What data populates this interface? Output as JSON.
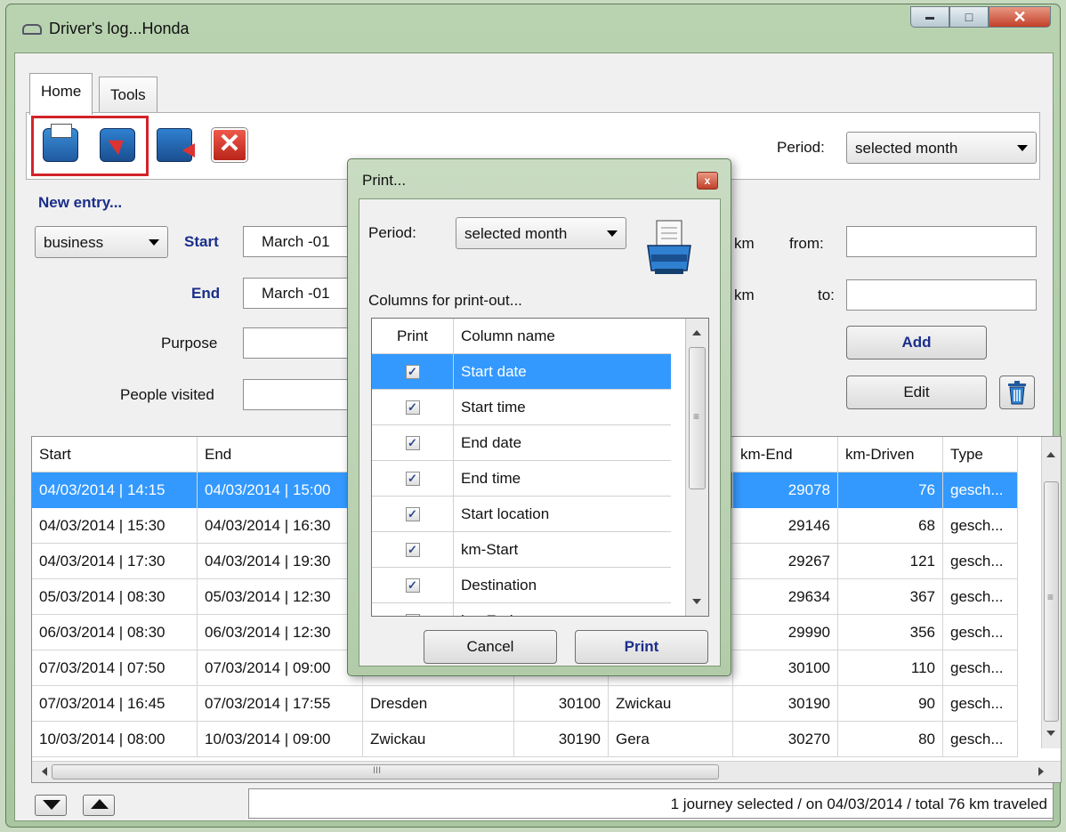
{
  "window": {
    "title": "Driver's log...Honda",
    "min_glyph": "▬",
    "max_glyph": "□",
    "close_glyph": "✕"
  },
  "tabs": [
    {
      "label": "Home"
    },
    {
      "label": "Tools"
    }
  ],
  "toolbar": {
    "period_label": "Period:",
    "period_value": "selected month"
  },
  "entry": {
    "heading": "New entry...",
    "type_value": "business",
    "start_label": "Start",
    "start_value": "March  -01",
    "end_label": "End",
    "end_value": "March  -01",
    "purpose_label": "Purpose",
    "purpose_value": "",
    "people_label": "People visited",
    "people_value": "",
    "km_label_1": "km",
    "from_label": "from:",
    "from_value": "",
    "km_label_2": "km",
    "to_label": "to:",
    "to_value": "",
    "add_label": "Add",
    "edit_label": "Edit"
  },
  "grid": {
    "columns": [
      "Start",
      "End",
      "",
      "",
      "",
      "km-End",
      "km-Driven",
      "Type"
    ],
    "rows": [
      [
        "04/03/2014 | 14:15",
        "04/03/2014 | 15:00",
        "",
        "",
        "",
        "29078",
        "76",
        "gesch..."
      ],
      [
        "04/03/2014 | 15:30",
        "04/03/2014 | 16:30",
        "",
        "",
        "",
        "29146",
        "68",
        "gesch..."
      ],
      [
        "04/03/2014 | 17:30",
        "04/03/2014 | 19:30",
        "",
        "",
        "",
        "29267",
        "121",
        "gesch..."
      ],
      [
        "05/03/2014 | 08:30",
        "05/03/2014 | 12:30",
        "",
        "",
        "",
        "29634",
        "367",
        "gesch..."
      ],
      [
        "06/03/2014 | 08:30",
        "06/03/2014 | 12:30",
        "",
        "",
        "",
        "29990",
        "356",
        "gesch..."
      ],
      [
        "07/03/2014 | 07:50",
        "07/03/2014 | 09:00",
        "",
        "",
        "",
        "30100",
        "110",
        "gesch..."
      ],
      [
        "07/03/2014 | 16:45",
        "07/03/2014 | 17:55",
        "Dresden",
        "30100",
        "Zwickau",
        "30190",
        "90",
        "gesch..."
      ],
      [
        "10/03/2014 | 08:00",
        "10/03/2014 | 09:00",
        "Zwickau",
        "30190",
        "Gera",
        "30270",
        "80",
        "gesch..."
      ]
    ],
    "selected_row": 0,
    "hscroll_grip": "III",
    "vscroll_grip": "≡"
  },
  "status": {
    "text": "1 journey selected / on 04/03/2014 / total 76 km traveled"
  },
  "dialog": {
    "title": "Print...",
    "close_glyph": "x",
    "period_label": "Period:",
    "period_value": "selected month",
    "columns_label": "Columns for print-out...",
    "col_header_print": "Print",
    "col_header_name": "Column name",
    "columns": [
      {
        "name": "Start date",
        "checked": true
      },
      {
        "name": "Start time",
        "checked": true
      },
      {
        "name": "End date",
        "checked": true
      },
      {
        "name": "End time",
        "checked": true
      },
      {
        "name": "Start location",
        "checked": true
      },
      {
        "name": "km-Start",
        "checked": true
      },
      {
        "name": "Destination",
        "checked": true
      },
      {
        "name": "km-End",
        "checked": true
      }
    ],
    "check_glyph": "✓",
    "scroll_grip": "≡",
    "cancel_label": "Cancel",
    "print_label": "Print"
  },
  "colors": {
    "selection": "#3399ff",
    "highlight_box": "#d2232a",
    "accent_text": "#1a2e8a"
  }
}
